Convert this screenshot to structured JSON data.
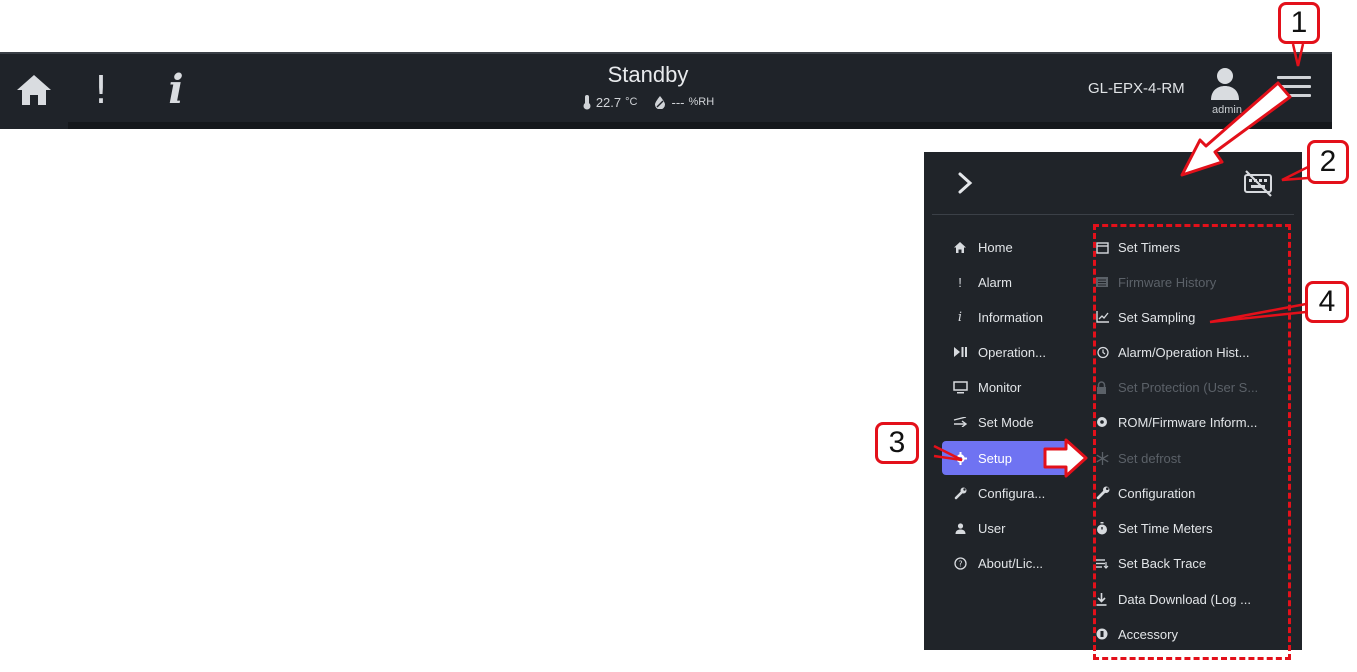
{
  "topbar": {
    "status_title": "Standby",
    "temperature": "22.7",
    "temp_unit": "°C",
    "humidity": "---",
    "humidity_unit": "%RH",
    "device_name": "GL-EPX-4-RM",
    "user_name": "admin",
    "icons": [
      "home-icon",
      "alarm-icon",
      "info-icon",
      "thermometer-icon",
      "humidity-icon",
      "user-icon",
      "menu-icon"
    ]
  },
  "panel": {
    "icons": [
      "chevron-right-icon",
      "keyboard-off-icon"
    ],
    "nav_items": [
      {
        "icon": "home",
        "label": "Home"
      },
      {
        "icon": "!",
        "label": "Alarm"
      },
      {
        "icon": "i",
        "label": "Information"
      },
      {
        "icon": "play-pause",
        "label": "Operation..."
      },
      {
        "icon": "monitor",
        "label": "Monitor"
      },
      {
        "icon": "swap",
        "label": "Set Mode"
      },
      {
        "icon": "gear",
        "label": "Setup",
        "active": true
      },
      {
        "icon": "wrench",
        "label": "Configura..."
      },
      {
        "icon": "user",
        "label": "User"
      },
      {
        "icon": "help",
        "label": "About/Lic..."
      }
    ],
    "sub_items": [
      {
        "icon": "calendar",
        "label": "Set Timers",
        "disabled": false
      },
      {
        "icon": "list",
        "label": "Firmware History",
        "disabled": true
      },
      {
        "icon": "chart",
        "label": "Set Sampling",
        "disabled": false
      },
      {
        "icon": "history",
        "label": "Alarm/Operation Hist...",
        "disabled": false
      },
      {
        "icon": "lock",
        "label": "Set Protection (User S...",
        "disabled": true
      },
      {
        "icon": "dot",
        "label": "ROM/Firmware Inform...",
        "disabled": false
      },
      {
        "icon": "snowflake",
        "label": "Set defrost",
        "disabled": true
      },
      {
        "icon": "wrench",
        "label": "Configuration",
        "disabled": false
      },
      {
        "icon": "stopwatch",
        "label": "Set Time Meters",
        "disabled": false
      },
      {
        "icon": "trace",
        "label": "Set Back Trace",
        "disabled": false
      },
      {
        "icon": "download",
        "label": "Data Download (Log ...",
        "disabled": false
      },
      {
        "icon": "badge",
        "label": "Accessory",
        "disabled": false
      }
    ],
    "active_color": "#6f73f2"
  },
  "annotations": {
    "labels": [
      "1",
      "2",
      "3",
      "4"
    ],
    "color": "#e3101a"
  }
}
